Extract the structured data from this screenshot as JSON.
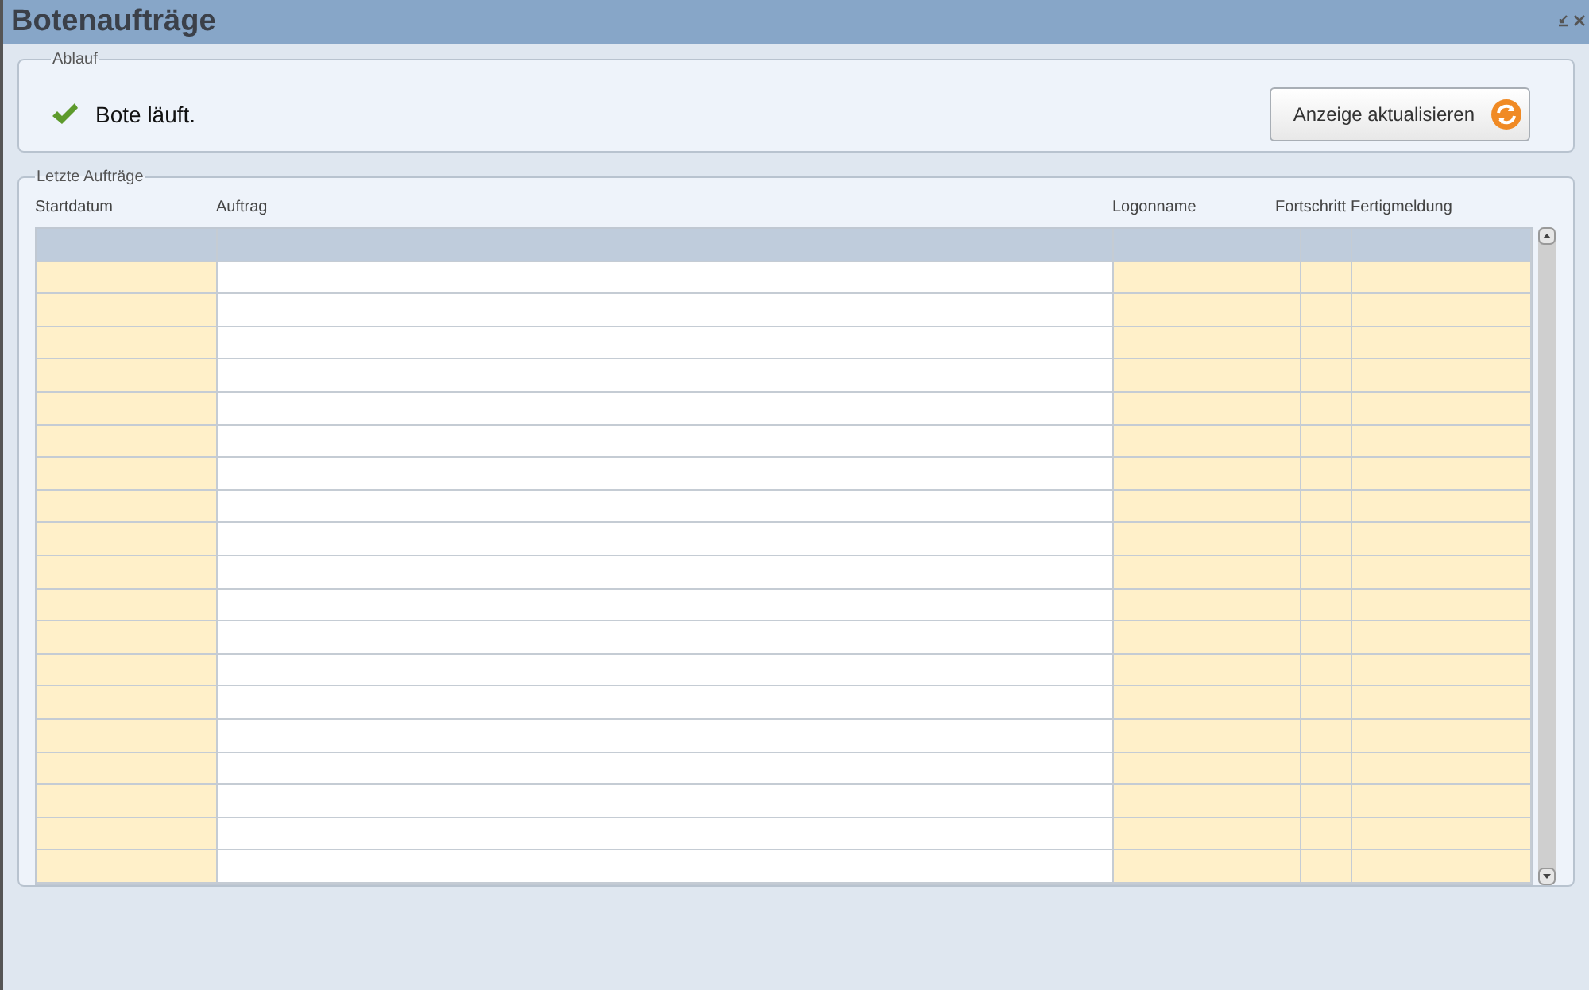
{
  "window": {
    "title": "Botenaufträge"
  },
  "status_group": {
    "legend": "Ablauf",
    "status": "Bote läuft.",
    "refresh_button": "Anzeige aktualisieren"
  },
  "orders_group": {
    "legend": "Letzte Aufträge",
    "table": {
      "columns": [
        "Startdatum",
        "Auftrag",
        "Logonname",
        "Fortschritt",
        "Fertigmeldung"
      ]
    }
  }
}
